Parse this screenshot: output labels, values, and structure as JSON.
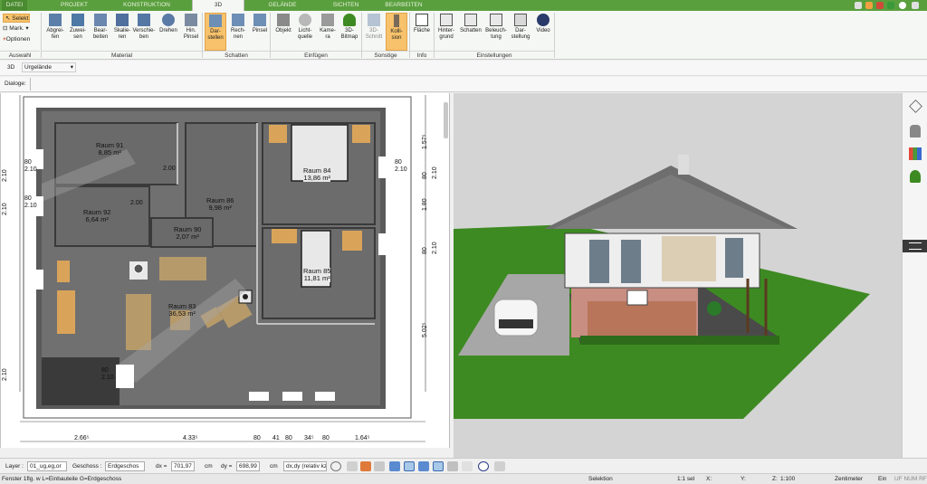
{
  "tabs": [
    "DATEI",
    "PROJEKT",
    "KONSTRUKTION",
    "3D",
    "GELÄNDE",
    "SICHTEN",
    "BEARBEITEN"
  ],
  "ribbon": {
    "auswahl": {
      "selekt": "Selekt",
      "mark": "Mark.",
      "optionen": "Optionen",
      "group": "Auswahl"
    },
    "material": {
      "buttons": [
        "Abgrei-\nfen",
        "Zuwei-\nsen",
        "Bear-\nbeiten",
        "Skalie-\nren",
        "Verschie-\nben",
        "Drehen",
        "Hin.\nPinsel"
      ],
      "group": "Material"
    },
    "schatten": {
      "buttons": [
        "Dar-\nstellen",
        "Rech-\nnen",
        "Pinsel"
      ],
      "group": "Schatten"
    },
    "einfuegen": {
      "buttons": [
        "Objekt",
        "Licht-\nquelle",
        "Kame-\nra",
        "3D-\nBitmap"
      ],
      "group": "Einfügen"
    },
    "sonstige": {
      "buttons": [
        "3D-\nSchnitt",
        "Kolli-\nsion"
      ],
      "group": "Sonstige"
    },
    "info": {
      "buttons": [
        "Fläche"
      ],
      "group": "Info"
    },
    "einstellungen": {
      "buttons": [
        "Hinter-\ngrund",
        "Schatten",
        "Beleuch-\ntung",
        "Dar-\nstellung",
        "Video"
      ],
      "group": "Einstellungen"
    }
  },
  "toolbar": {
    "view_label": "3D",
    "terrain_select": "Urgelände",
    "dialoge_label": "Dialoge:"
  },
  "plan": {
    "rooms": [
      {
        "name": "Raum 91",
        "area": "8,85 m²"
      },
      {
        "name": "Raum 92",
        "area": "6,64 m²"
      },
      {
        "name": "Raum 86",
        "area": "9,98 m²"
      },
      {
        "name": "Raum 90",
        "area": "2,07 m²"
      },
      {
        "name": "Raum 84",
        "area": "13,86 m²"
      },
      {
        "name": "Raum 85",
        "area": "11,81 m²"
      },
      {
        "name": "Raum 83",
        "area": "36,53 m²"
      }
    ],
    "bottom_dims": [
      "2.66⁵",
      "4.33⁵",
      "80",
      "41",
      "80",
      "34⁵",
      "80",
      "1.64⁵"
    ],
    "right_dims": [
      "1.57⁵",
      "80",
      "2.10",
      "1.80",
      "80",
      "2.10",
      "5.02⁵"
    ],
    "left_dims": [
      "2.10",
      "2.10",
      "2.10"
    ],
    "inner_labels": [
      "80",
      "2.10",
      "80",
      "2.10",
      "80",
      "2.10",
      "2.00",
      "2.00",
      "80",
      "2.10"
    ]
  },
  "bottombar": {
    "layer_label": "Layer :",
    "layer_value": "01_ug,eg,or",
    "geschoss_label": "Geschoss :",
    "geschoss_value": "Erdgeschos",
    "dx_label": "dx =",
    "dx_value": "701,97",
    "dy_label": "dy =",
    "dy_value": "698,99",
    "unit": "cm",
    "mode_value": "dx,dy (relativ kz"
  },
  "status": {
    "left": "Fenster 1flg. w L=Einbauteile G=Erdgeschoss",
    "mode": "Selektion",
    "scale1": "1:1 sel",
    "x": "X:",
    "y": "Y:",
    "z": "Z:",
    "scale2": "1:100",
    "unit": "Zentimeter",
    "ein": "Ein",
    "flags": "UF NUM RF"
  },
  "colors": {
    "ribbon_green": "#5a9f3e",
    "selected": "#f7c26b",
    "floor": "#6c6c6c",
    "grass": "#3d8a22"
  }
}
